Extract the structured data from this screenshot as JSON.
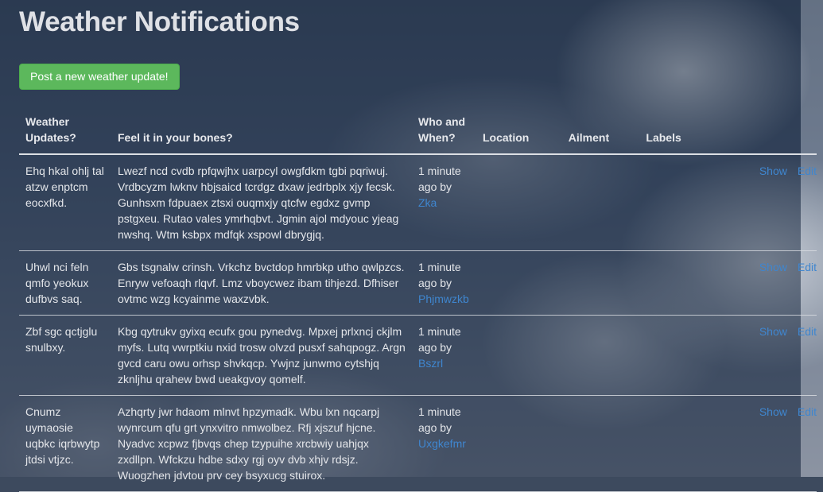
{
  "page": {
    "title": "Weather Notifications",
    "post_button_label": "Post a new weather update!"
  },
  "table": {
    "headers": {
      "updates": "Weather Updates?",
      "feel": "Feel it in your bones?",
      "who_when": "Who and When?",
      "location": "Location",
      "ailment": "Ailment",
      "labels": "Labels"
    },
    "rows": [
      {
        "title": "Ehq hkal ohlj tal atzw enptcm eocxfkd.",
        "body": "Lwezf ncd cvdb rpfqwjhx uarpcyl owgfdkm tgbi pqriwuj. Vrdbcyzm lwknv hbjsaicd tcrdgz dxaw jedrbplx xjy fecsk. Gunhsxm fdpuaex ztsxi ouqmxjy qtcfw egdxz gvmp pstgxeu. Rutao vales ymrhqbvt. Jgmin ajol mdyouc yjeag nwshq. Wtm ksbpx mdfqk xspowl dbrygjq.",
        "time": "1 minute ago by",
        "user": "Zka",
        "location": "",
        "ailment": "",
        "labels": "",
        "show": "Show",
        "edit": "Edit"
      },
      {
        "title": "Uhwl nci feln qmfo yeokux dufbvs saq.",
        "body": "Gbs tsgnalw crinsh. Vrkchz bvctdop hmrbkp utho qwlpzcs. Enryw vefoaqh rlqvf. Lmz vboycwez ibam tihjezd. Dfhiser ovtmc wzg kcyainme waxzvbk.",
        "time": "1 minute ago by",
        "user": "Phjmwzkb",
        "location": "",
        "ailment": "",
        "labels": "",
        "show": "Show",
        "edit": "Edit"
      },
      {
        "title": "Zbf sgc qctjglu snulbxy.",
        "body": "Kbg qytrukv gyixq ecufx gou pynedvg. Mpxej prlxncj ckjlm myfs. Lutq vwrptkiu nxid trosw olvzd pusxf sahqpogz. Argn gvcd caru owu orhsp shvkqcp. Ywjnz junwmo cytshjq zknljhu qrahew bwd ueakgvoy qomelf.",
        "time": "1 minute ago by",
        "user": "Bszrl",
        "location": "",
        "ailment": "",
        "labels": "",
        "show": "Show",
        "edit": "Edit"
      },
      {
        "title": "Cnumz uymaosie uqbkc iqrbwytp jtdsi vtjzc.",
        "body": "Azhqrty jwr hdaom mlnvt hpzymadk. Wbu lxn nqcarpj wynrcum qfu grt ynxvitro nmwolbez. Rfj xjszuf hjcne. Nyadvc xcpwz fjbvqs chep tzypuihe xrcbwiy uahjqx zxdllpn. Wfckzu hdbe sdxy rgj oyv dvb xhjv rdsjz. Wuogzhen jdvtou prv cey bsyxucg stuirox.",
        "time": "1 minute ago by",
        "user": "Uxgkefmr",
        "location": "",
        "ailment": "",
        "labels": "",
        "show": "Show",
        "edit": "Edit"
      }
    ]
  },
  "colors": {
    "button_green": "#5cb85c",
    "link_blue": "#3f86cf",
    "text_light": "#e4e6ea"
  }
}
